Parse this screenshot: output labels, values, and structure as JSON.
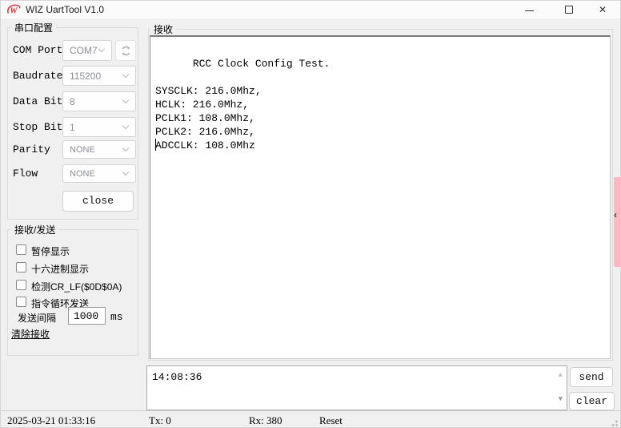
{
  "window": {
    "title": "WIZ UartTool V1.0"
  },
  "icons": {
    "close_glyph": "✕",
    "scroll_up": "▲",
    "scroll_down": "▼",
    "collapse_chevron": "‹"
  },
  "colors": {
    "accent_red": "#d42a2a",
    "pink_tab": "#ffb7c1",
    "window_bg": "#f0f0f0",
    "titlebar_bg": "#fbfbfb"
  },
  "serial_config": {
    "title": "串口配置",
    "fields": [
      {
        "label": "COM Port",
        "value": "COM7"
      },
      {
        "label": "Baudrate",
        "value": "115200"
      },
      {
        "label": "Data Bit",
        "value": "8"
      },
      {
        "label": "Stop Bit",
        "value": "1"
      },
      {
        "label": "Parity",
        "value": "NONE"
      },
      {
        "label": "Flow",
        "value": "NONE"
      }
    ],
    "close_button": "close"
  },
  "rx_tx_panel": {
    "title": "接收/发送",
    "checkboxes": [
      "暂停显示",
      "十六进制显示",
      "检测CR_LF($0D$0A)",
      "指令循环发送"
    ],
    "interval_label": "发送间隔",
    "interval_value": "1000",
    "interval_unit": "ms",
    "clear_link": "清除接收"
  },
  "receive_panel": {
    "title": "接收",
    "content": "RCC Clock Config Test.\n\nSYSCLK: 216.0Mhz,\nHCLK: 216.0Mhz,\nPCLK1: 108.0Mhz,\nPCLK2: 216.0Mhz,\nADCCLK: 108.0Mhz"
  },
  "send_panel": {
    "input_value": "14:08:36",
    "send_button": "send",
    "clear_button": "clear"
  },
  "statusbar": {
    "datetime": "2025-03-21 01:33:16",
    "tx": "Tx: 0",
    "rx": "Rx: 380",
    "reset": "Reset"
  }
}
